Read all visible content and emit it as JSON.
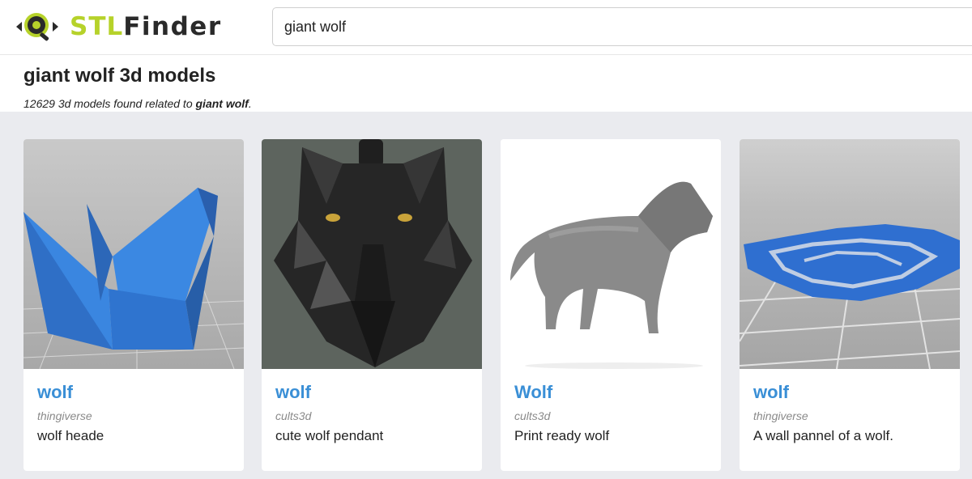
{
  "brand": {
    "part1": "STL",
    "part2": "Finder"
  },
  "search": {
    "value": "giant wolf"
  },
  "page": {
    "title": "giant wolf 3d models",
    "count": "12629",
    "count_mid": " 3d models found related to ",
    "query": "giant wolf",
    "count_end": "."
  },
  "results": [
    {
      "title": "wolf",
      "source": "thingiverse",
      "description": "wolf heade"
    },
    {
      "title": "wolf",
      "source": "cults3d",
      "description": "cute wolf pendant"
    },
    {
      "title": "Wolf",
      "source": "cults3d",
      "description": "Print ready wolf"
    },
    {
      "title": "wolf",
      "source": "thingiverse",
      "description": "A wall pannel of a wolf."
    }
  ],
  "colors": {
    "brand_green": "#b6d22a",
    "link_blue": "#3a8fd6",
    "grid_bg": "#eaebef"
  },
  "icons": {
    "logo": "magnifier-eye-logo-icon"
  }
}
